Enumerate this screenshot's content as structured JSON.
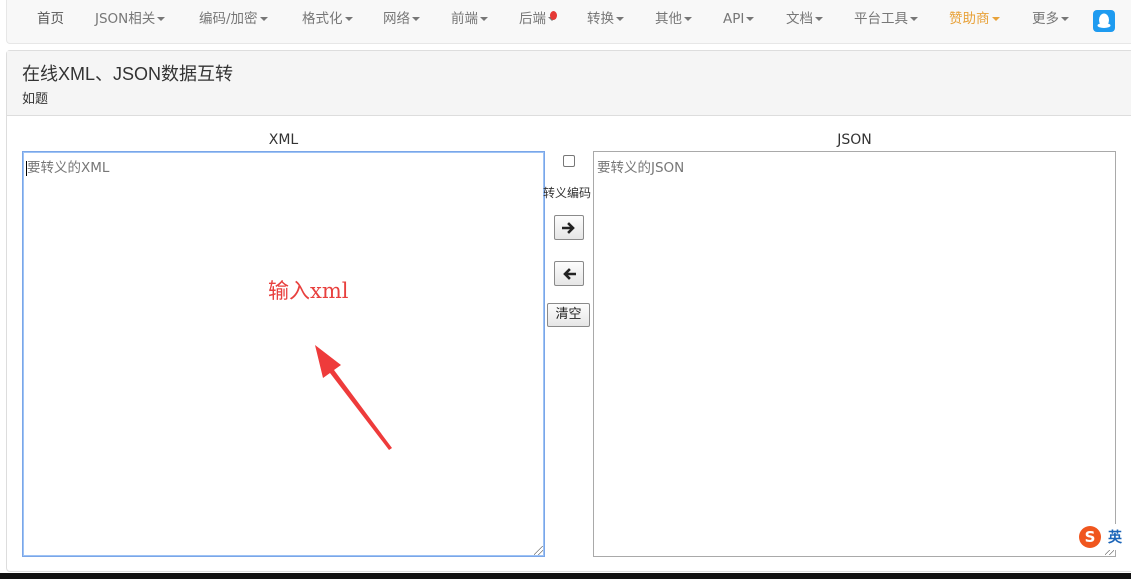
{
  "nav": {
    "items": [
      {
        "label": "首页",
        "caret": false
      },
      {
        "label": "JSON相关",
        "caret": true
      },
      {
        "label": "编码/加密",
        "caret": true
      },
      {
        "label": "格式化",
        "caret": true
      },
      {
        "label": "网络",
        "caret": true
      },
      {
        "label": "前端",
        "caret": true
      },
      {
        "label": "后端",
        "caret": true
      },
      {
        "label": "转换",
        "caret": true
      },
      {
        "label": "其他",
        "caret": true
      },
      {
        "label": "API",
        "caret": true
      },
      {
        "label": "文档",
        "caret": true
      },
      {
        "label": "平台工具",
        "caret": true
      },
      {
        "label": "赞助商",
        "caret": true
      },
      {
        "label": "更多",
        "caret": true
      }
    ],
    "sponsor_color": "#e8a23a",
    "qq_icon": "qq-penguin-icon"
  },
  "panel": {
    "title": "在线XML、JSON数据互转",
    "subtitle": "如题"
  },
  "xml": {
    "label": "XML",
    "placeholder": "要转义的XML"
  },
  "json": {
    "label": "JSON",
    "placeholder": "要转义的JSON"
  },
  "controls": {
    "escape_label": "转义编码",
    "escape_checked": false,
    "to_json_icon": "arrow-right-icon",
    "to_xml_icon": "arrow-left-icon",
    "clear_label": "清空"
  },
  "annotation": {
    "text": "输入xml",
    "color": "#e8403e"
  },
  "ime": {
    "logo": "S",
    "lang": "英"
  }
}
